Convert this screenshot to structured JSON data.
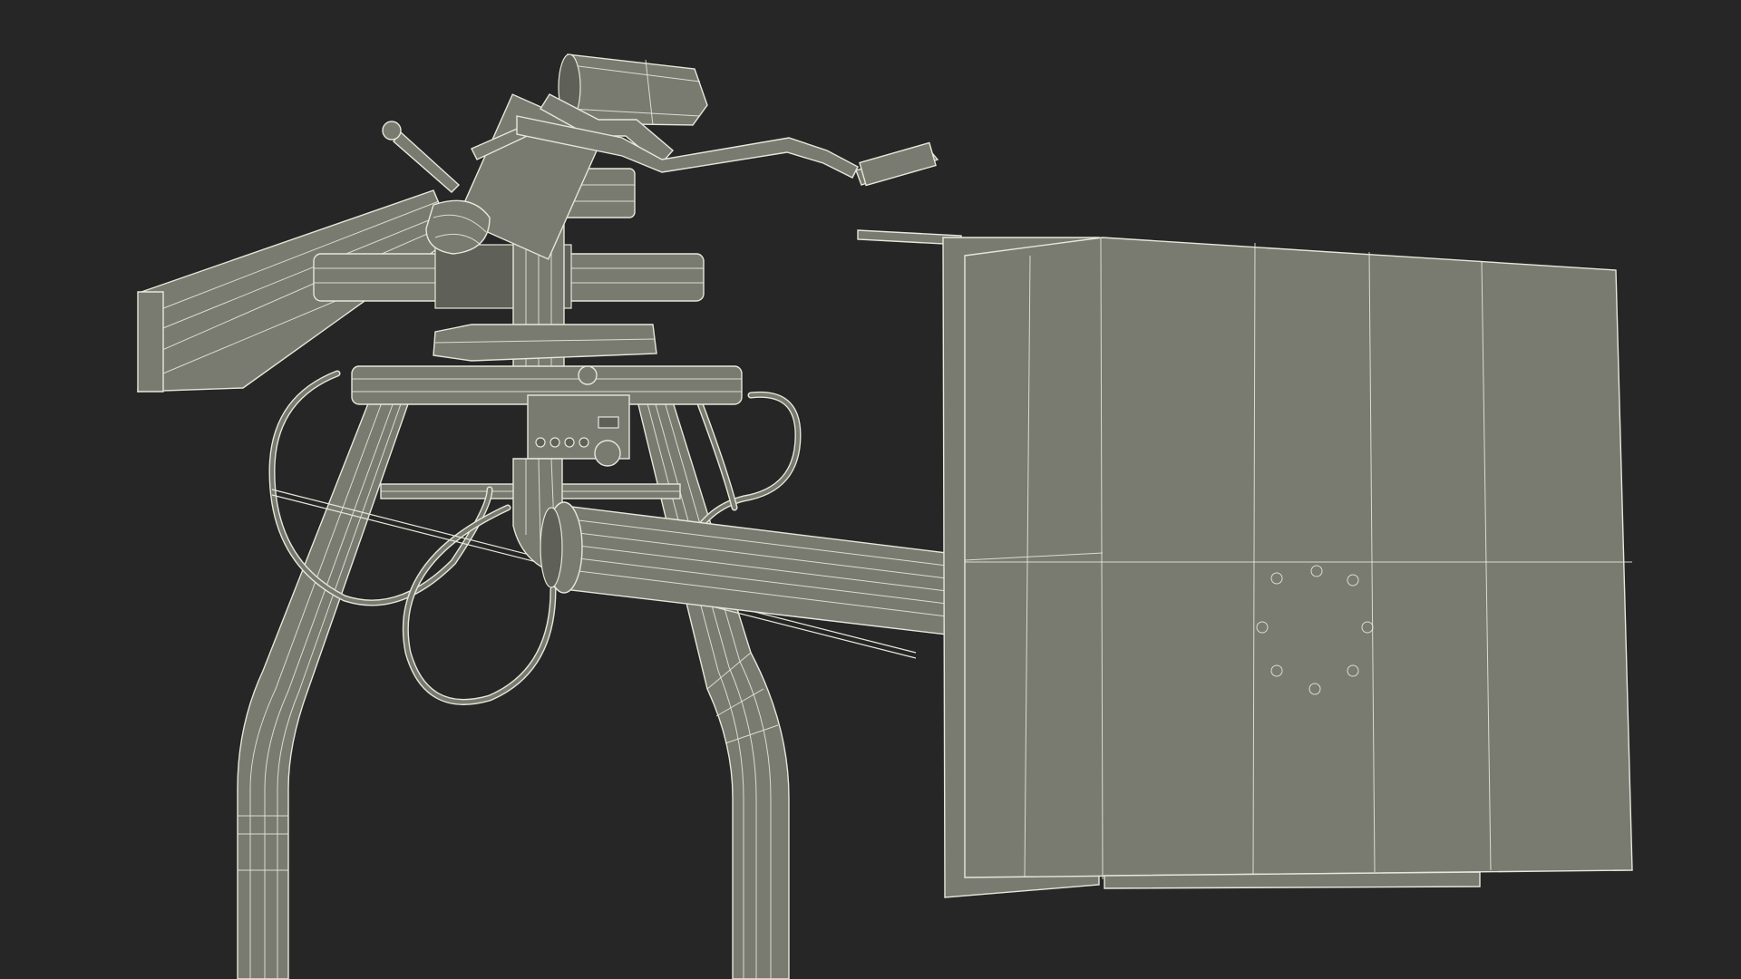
{
  "scene": {
    "subject": "",
    "background_color": "#262626",
    "model_fill_color": "#7a7b70",
    "wire_color": "#e6e6da"
  }
}
